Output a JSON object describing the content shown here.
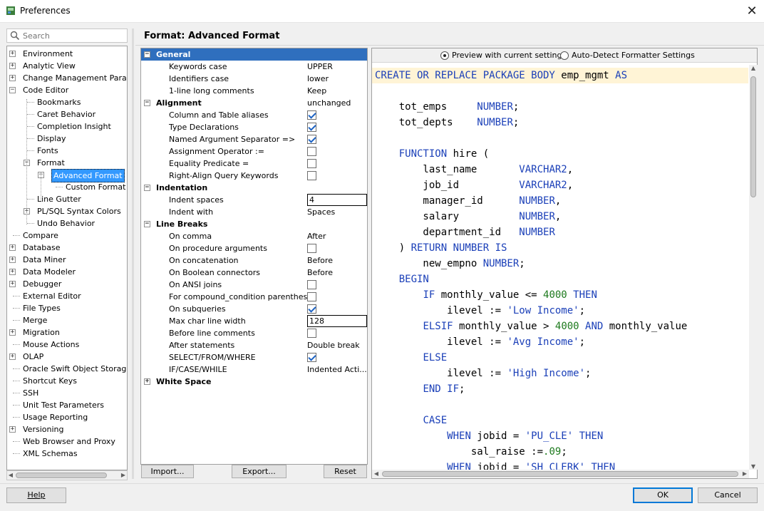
{
  "window": {
    "title": "Preferences",
    "close_glyph": "✕"
  },
  "search": {
    "placeholder": "Search"
  },
  "tree": [
    {
      "label": "Environment",
      "toggle": "+"
    },
    {
      "label": "Analytic View",
      "toggle": "+"
    },
    {
      "label": "Change Management Paramet",
      "toggle": "+"
    },
    {
      "label": "Code Editor",
      "toggle": "−"
    },
    {
      "label": "Bookmarks",
      "toggle": ""
    },
    {
      "label": "Caret Behavior",
      "toggle": ""
    },
    {
      "label": "Completion Insight",
      "toggle": ""
    },
    {
      "label": "Display",
      "toggle": ""
    },
    {
      "label": "Fonts",
      "toggle": ""
    },
    {
      "label": "Format",
      "toggle": "−"
    },
    {
      "label": "Advanced Format",
      "toggle": "−"
    },
    {
      "label": "Custom Format",
      "toggle": ""
    },
    {
      "label": "Line Gutter",
      "toggle": ""
    },
    {
      "label": "PL/SQL Syntax Colors",
      "toggle": "+"
    },
    {
      "label": "Undo Behavior",
      "toggle": ""
    },
    {
      "label": "Compare",
      "toggle": ""
    },
    {
      "label": "Database",
      "toggle": "+"
    },
    {
      "label": "Data Miner",
      "toggle": "+"
    },
    {
      "label": "Data Modeler",
      "toggle": "+"
    },
    {
      "label": "Debugger",
      "toggle": "+"
    },
    {
      "label": "External Editor",
      "toggle": ""
    },
    {
      "label": "File Types",
      "toggle": ""
    },
    {
      "label": "Merge",
      "toggle": ""
    },
    {
      "label": "Migration",
      "toggle": "+"
    },
    {
      "label": "Mouse Actions",
      "toggle": ""
    },
    {
      "label": "OLAP",
      "toggle": "+"
    },
    {
      "label": "Oracle Swift Object Storage",
      "toggle": ""
    },
    {
      "label": "Shortcut Keys",
      "toggle": ""
    },
    {
      "label": "SSH",
      "toggle": ""
    },
    {
      "label": "Unit Test Parameters",
      "toggle": ""
    },
    {
      "label": "Usage Reporting",
      "toggle": ""
    },
    {
      "label": "Versioning",
      "toggle": "+"
    },
    {
      "label": "Web Browser and Proxy",
      "toggle": ""
    },
    {
      "label": "XML Schemas",
      "toggle": ""
    }
  ],
  "page_title": "Format: Advanced Format",
  "groups": {
    "general": "General",
    "alignment": "Alignment",
    "indentation": "Indentation",
    "line_breaks": "Line Breaks",
    "white_space": "White Space",
    "toggle_open": "−",
    "toggle_closed": "+"
  },
  "general": [
    {
      "label": "Keywords case",
      "value": "UPPER"
    },
    {
      "label": "Identifiers case",
      "value": "lower"
    },
    {
      "label": "1-line long comments",
      "value": "Keep unchanged"
    }
  ],
  "alignment": [
    {
      "label": "Column and Table aliases",
      "checked": true
    },
    {
      "label": "Type Declarations",
      "checked": true
    },
    {
      "label": "Named Argument Separator =>",
      "checked": true
    },
    {
      "label": "Assignment Operator :=",
      "checked": false
    },
    {
      "label": "Equality Predicate =",
      "checked": false
    },
    {
      "label": "Right-Align Query Keywords",
      "checked": false
    }
  ],
  "indentation": {
    "indent_spaces_label": "Indent spaces",
    "indent_spaces_value": "4",
    "indent_with_label": "Indent with",
    "indent_with_value": "Spaces"
  },
  "line_breaks": {
    "on_comma": {
      "label": "On comma",
      "value": "After"
    },
    "on_proc_args": {
      "label": "On procedure arguments",
      "checked": false
    },
    "on_concat": {
      "label": "On concatenation",
      "value": "Before"
    },
    "on_bool": {
      "label": "On Boolean connectors",
      "value": "Before"
    },
    "on_ansi": {
      "label": "On ANSI joins",
      "checked": false
    },
    "compound": {
      "label": "For compound_condition parenthesis",
      "checked": false
    },
    "subqueries": {
      "label": "On subqueries",
      "checked": true
    },
    "max_width": {
      "label": "Max char line width",
      "value": "128"
    },
    "before_comments": {
      "label": "Before line comments",
      "checked": false
    },
    "after_statements": {
      "label": "After statements",
      "value": "Double break"
    },
    "select_from_where": {
      "label": "SELECT/FROM/WHERE",
      "checked": true
    },
    "if_case_while": {
      "label": "IF/CASE/WHILE",
      "value": "Indented Acti..."
    }
  },
  "buttons": {
    "import": "Import...",
    "export": "Export...",
    "reset": "Reset"
  },
  "preview": {
    "radio_current": "Preview with current settings",
    "radio_autodetect": "Auto-Detect Formatter Settings",
    "selected": "current"
  },
  "code": {
    "l01_kw": "CREATE OR REPLACE PACKAGE BODY",
    "l01_id": " emp_mgmt ",
    "l01_kw2": "AS",
    "l03_id": "    tot_emps     ",
    "l03_kw": "NUMBER",
    "l03_p": ";",
    "l04_id": "    tot_depts    ",
    "l04_kw": "NUMBER",
    "l04_p": ";",
    "l06_pre": "    ",
    "l06_kw": "FUNCTION",
    "l06_id": " hire (",
    "l07_id": "        last_name       ",
    "l07_kw": "VARCHAR2",
    "l07_p": ",",
    "l08_id": "        job_id          ",
    "l08_kw": "VARCHAR2",
    "l08_p": ",",
    "l09_id": "        manager_id      ",
    "l09_kw": "NUMBER",
    "l09_p": ",",
    "l10_id": "        salary          ",
    "l10_kw": "NUMBER",
    "l10_p": ",",
    "l11_id": "        department_id   ",
    "l11_kw": "NUMBER",
    "l12_pre": "    ) ",
    "l12_kw": "RETURN NUMBER IS",
    "l13_id": "        new_empno ",
    "l13_kw": "NUMBER",
    "l13_p": ";",
    "l14_pre": "    ",
    "l14_kw": "BEGIN",
    "l15_pre": "        ",
    "l15_kw": "IF",
    "l15_id": " monthly_value <= ",
    "l15_num": "4000",
    "l15_kw2": " THEN",
    "l16_id": "            ilevel := ",
    "l16_str": "'Low Income'",
    "l16_p": ";",
    "l17_pre": "        ",
    "l17_kw": "ELSIF",
    "l17_id": " monthly_value > ",
    "l17_num": "4000",
    "l17_kw2": " AND",
    "l17_id2": " monthly_value",
    "l18_id": "            ilevel := ",
    "l18_str": "'Avg Income'",
    "l18_p": ";",
    "l19_pre": "        ",
    "l19_kw": "ELSE",
    "l20_id": "            ilevel := ",
    "l20_str": "'High Income'",
    "l20_p": ";",
    "l21_pre": "        ",
    "l21_kw": "END IF",
    "l21_p": ";",
    "l23_pre": "        ",
    "l23_kw": "CASE",
    "l24_pre": "            ",
    "l24_kw": "WHEN",
    "l24_id": " jobid = ",
    "l24_str": "'PU_CLE'",
    "l24_kw2": " THEN",
    "l25_id": "                sal_raise :=",
    "l25_num": ".09",
    "l25_p": ";",
    "l26_pre": "            ",
    "l26_kw": "WHEN",
    "l26_id": " jobid = ",
    "l26_str": "'SH_CLERK'",
    "l26_kw2": " THEN"
  },
  "footer": {
    "help": "Help",
    "ok": "OK",
    "cancel": "Cancel"
  },
  "colors": {
    "keyword": "#1a3fb8",
    "number": "#1d7a1d",
    "selection": "#3399ff",
    "group_header": "#2f6fbe",
    "preview_highlight": "#fff4d6"
  }
}
